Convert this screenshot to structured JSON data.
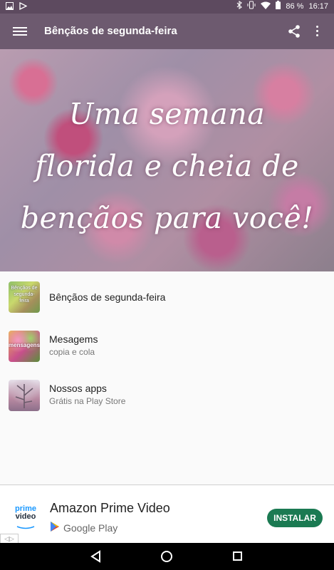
{
  "status_bar": {
    "battery_percent": "86 %",
    "time": "16:17"
  },
  "toolbar": {
    "title": "Bênçãos de segunda-feira",
    "icons": [
      "menu-icon",
      "share-icon",
      "more-vert-icon"
    ]
  },
  "hero": {
    "text_lines": [
      "Uma semana",
      "florida e cheia de",
      "bençãos para você!"
    ]
  },
  "list": {
    "items": [
      {
        "title": "Bênçãos de segunda-feira",
        "subtitle": "",
        "icon_label": "Bênçãos de segunda-feira"
      },
      {
        "title": "Mesagems",
        "subtitle": "copia e cola",
        "icon_label": "mensagens"
      },
      {
        "title": "Nossos apps",
        "subtitle": "Grátis na Play Store",
        "icon_label": ""
      }
    ]
  },
  "ad": {
    "logo_top": "prime",
    "logo_bottom": "video",
    "title": "Amazon Prime Video",
    "store": "Google Play",
    "install_label": "INSTALAR",
    "install_color": "#1b7a52",
    "choices_label": "◁▷"
  },
  "colors": {
    "toolbar": "#6d5a6f",
    "status_bar": "#5d4a5f"
  }
}
